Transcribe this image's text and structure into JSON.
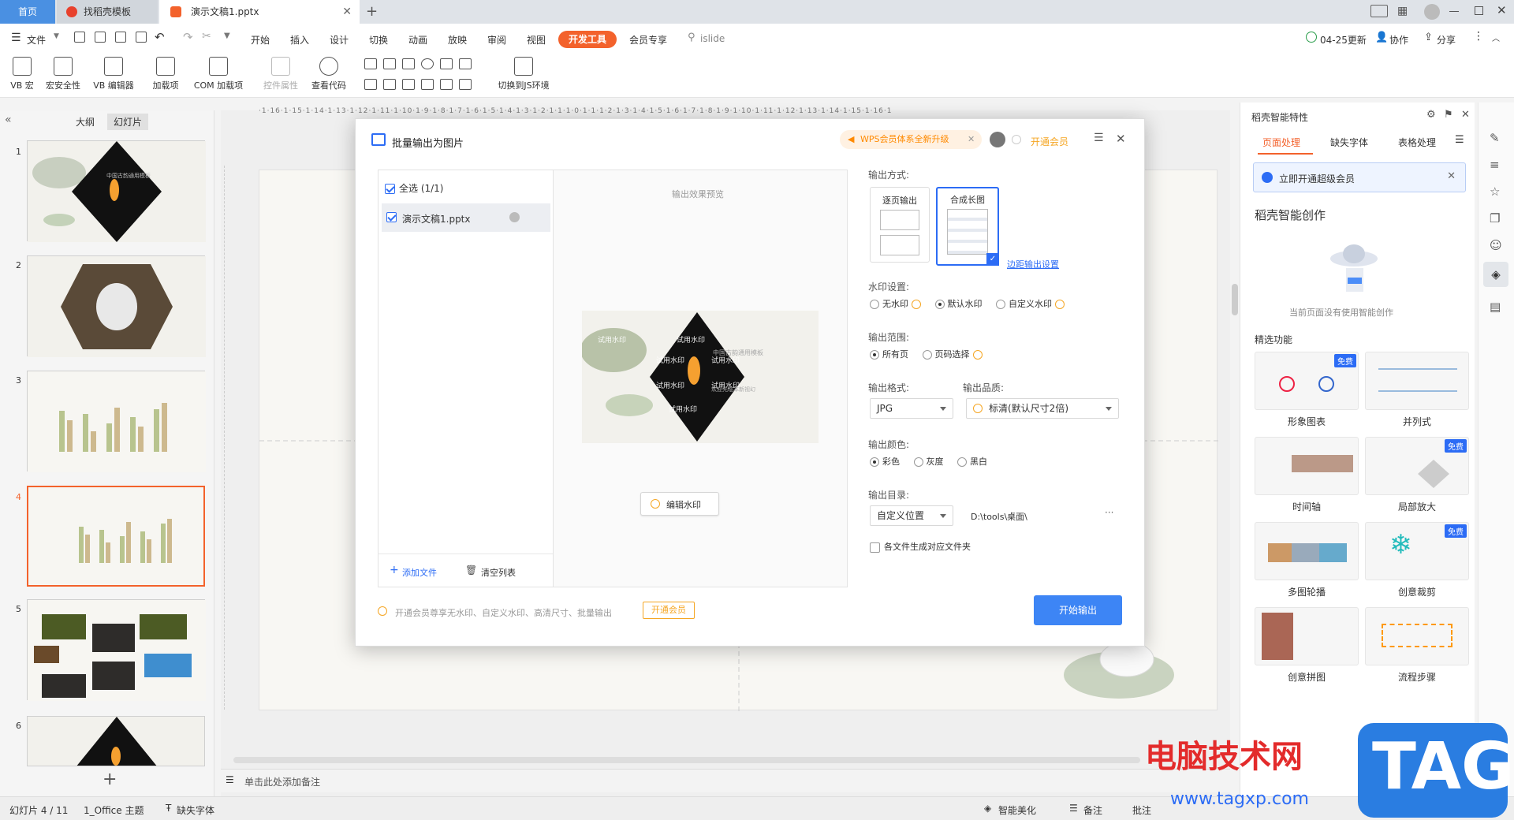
{
  "tabs": {
    "home": "首页",
    "templates": "找稻壳模板",
    "doc": "演示文稿1.pptx"
  },
  "menu": {
    "file": "文件",
    "items": [
      "开始",
      "插入",
      "设计",
      "切换",
      "动画",
      "放映",
      "审阅",
      "视图"
    ],
    "dev": "开发工具",
    "member": "会员专享",
    "search": "islide",
    "update": "04-25更新",
    "collab": "协作",
    "share": "分享"
  },
  "ribbon": {
    "vb_macro": "VB 宏",
    "macro_security": "宏安全性",
    "vb_editor": "VB 编辑器",
    "addins": "加载项",
    "com_addins": "COM 加载项",
    "control_props": "控件属性",
    "view_code": "查看代码",
    "switch_js": "切换到JS环境"
  },
  "leftpanel": {
    "tab_outline": "大纲",
    "tab_slides": "幻灯片",
    "slides": [
      "1",
      "2",
      "3",
      "4",
      "5",
      "6"
    ],
    "add": "+"
  },
  "ruler": {
    "h": [
      "16",
      "15",
      "14",
      "13",
      "12",
      "11",
      "10",
      "9",
      "8",
      "7",
      "6",
      "5",
      "4",
      "3",
      "2",
      "1",
      "0",
      "1",
      "2",
      "3",
      "4",
      "5",
      "6",
      "7",
      "8",
      "9",
      "10",
      "11",
      "12",
      "13",
      "14",
      "15",
      "16"
    ]
  },
  "slide_text": {
    "title": "中国古韵通用模板",
    "sub": "欢迎光临本新视幻"
  },
  "notes": "单击此处添加备注",
  "dialog": {
    "title": "批量输出为图片",
    "promo": "WPS会员体系全新升级",
    "open_member": "开通会员",
    "select_all": "全选 (1/1)",
    "file": "演示文稿1.pptx",
    "add_file": "添加文件",
    "clear_list": "清空列表",
    "preview_label": "输出效果预览",
    "edit_watermark": "编辑水印",
    "watermark_text": "试用水印",
    "output_mode_label": "输出方式:",
    "mode_single": "逐页输出",
    "mode_long": "合成长图",
    "margin_settings": "边距输出设置",
    "watermark_label": "水印设置:",
    "wm_none": "无水印",
    "wm_default": "默认水印",
    "wm_custom": "自定义水印",
    "range_label": "输出范围:",
    "range_all": "所有页",
    "range_pages": "页码选择",
    "format_label": "输出格式:",
    "format_value": "JPG",
    "quality_label": "输出品质:",
    "quality_value": "标清(默认尺寸2倍)",
    "color_label": "输出颜色:",
    "color_color": "彩色",
    "color_gray": "灰度",
    "color_bw": "黑白",
    "dir_label": "输出目录:",
    "dir_type": "自定义位置",
    "dir_path": "D:\\tools\\桌面\\",
    "dir_more": "···",
    "each_folder": "各文件生成对应文件夹",
    "footer_text": "开通会员尊享无水印、自定义水印、高清尺寸、批量输出",
    "footer_member": "开通会员",
    "start": "开始输出"
  },
  "rightpanel": {
    "title": "稻壳智能特性",
    "tabs": [
      "页面处理",
      "缺失字体",
      "表格处理"
    ],
    "banner": "立即开通超级会员",
    "section1": "稻壳智能创作",
    "empty": "当前页面没有使用智能创作",
    "section2": "精选功能",
    "free": "免费",
    "cards": [
      "形象图表",
      "并列式",
      "时间轴",
      "局部放大",
      "多图轮播",
      "创意裁剪",
      "创意拼图",
      "流程步骤"
    ]
  },
  "status": {
    "slide": "幻灯片 4 / 11",
    "theme": "1_Office 主题",
    "missing_font": "缺失字体",
    "beautify": "智能美化",
    "notes": "备注",
    "comment": "批注"
  },
  "overlay": {
    "site": "电脑技术网",
    "url": "www.tagxp.com",
    "tag": "TAG"
  },
  "colors": {
    "accent": "#f3622c",
    "blue": "#2c6cf5",
    "promo": "#ff8a00"
  }
}
